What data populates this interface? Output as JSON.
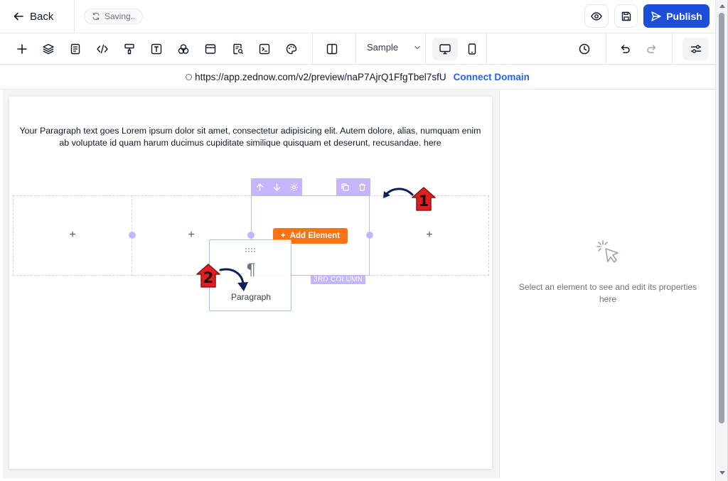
{
  "header": {
    "back_label": "Back",
    "saving_label": "Saving..",
    "publish_label": "Publish",
    "icons": [
      "arrow-left-icon",
      "refresh-icon",
      "eye-icon",
      "save-icon",
      "send-icon"
    ]
  },
  "toolbar": {
    "tools": [
      "plus-icon",
      "layers-icon",
      "page-icon",
      "code-icon",
      "paint-roller-icon",
      "text-icon",
      "shapes-icon",
      "window-icon",
      "search-doc-icon",
      "terminal-icon",
      "palette-icon",
      "columns-icon"
    ],
    "sample_label": "Sample",
    "devices": [
      "desktop-icon",
      "mobile-icon"
    ],
    "active_device": "desktop",
    "right_tools": [
      "history-icon",
      "undo-icon",
      "redo-icon",
      "sliders-icon"
    ]
  },
  "urlbar": {
    "url": "https://app.zednow.com/v2/preview/naP7AjrQ1FfgTbel7sfU",
    "connect_label": "Connect Domain"
  },
  "canvas": {
    "paragraph_text": "Your Paragraph text goes Lorem ipsum dolor sit amet, consectetur adipisicing elit. Autem dolore, alias, numquam enim ab voluptate id quam harum ducimus cupiditate similique quisquam et deserunt, recusandae. here",
    "add_element_label": "Add Element",
    "column_label": "3RD COLUMN",
    "drag_card_label": "Paragraph",
    "badges": [
      "1",
      "2"
    ],
    "accent_color": "#c4b5fd",
    "add_color": "#f97316"
  },
  "panel": {
    "hint": "Select an element to see and edit its properties here"
  }
}
